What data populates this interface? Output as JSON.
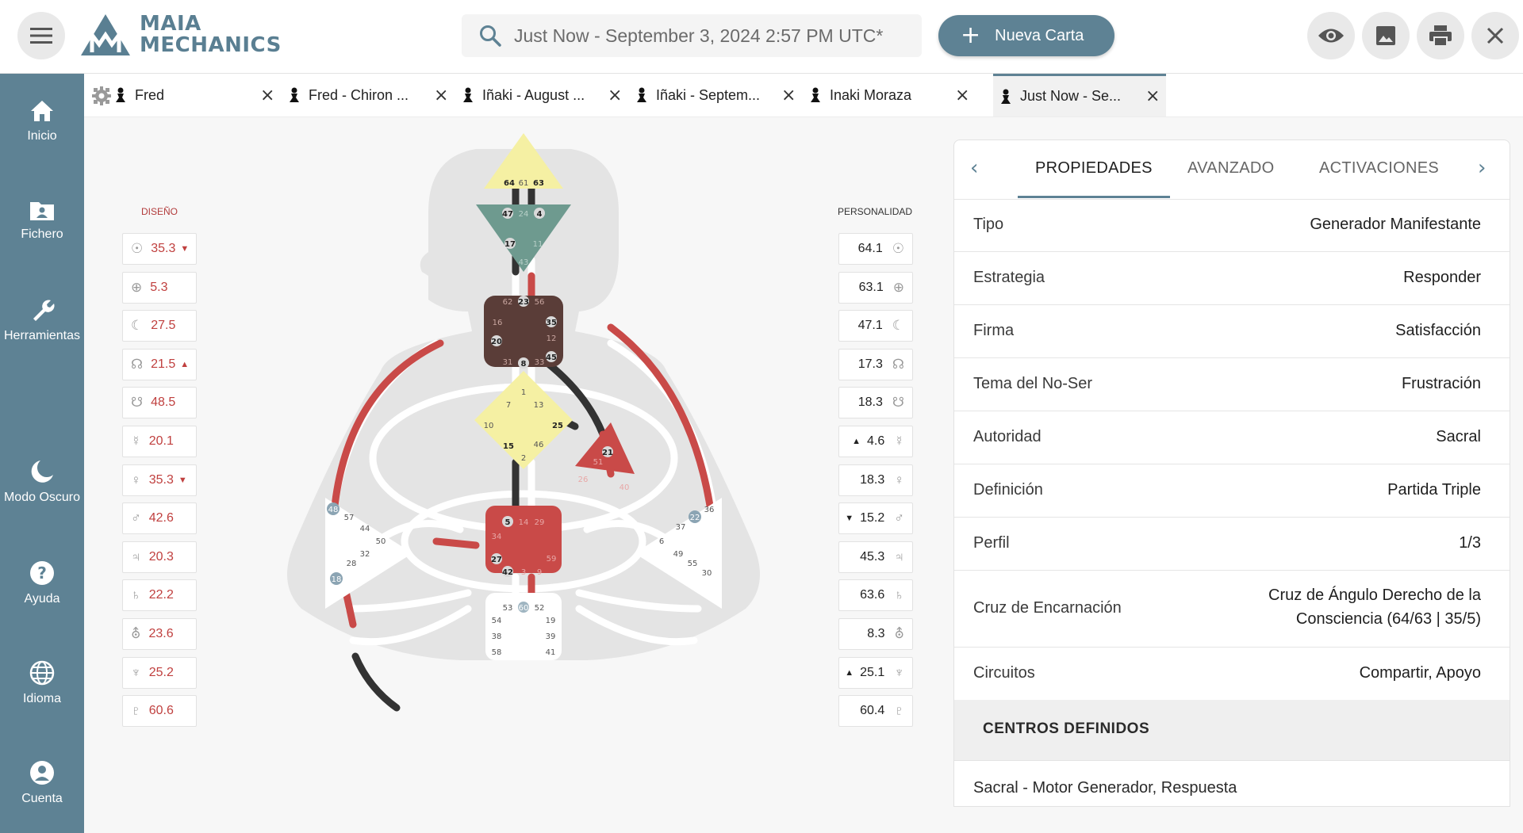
{
  "header": {
    "logo_line1": "MAIA",
    "logo_line2": "MECHANICS",
    "search_text": "Just Now - September 3, 2024 2:57 PM UTC*",
    "new_chart_label": "Nueva Carta",
    "accent_color": "#5e8294"
  },
  "sidebar": {
    "items": [
      {
        "label": "Inicio",
        "icon": "home-icon"
      },
      {
        "label": "Fichero",
        "icon": "folder-user-icon"
      },
      {
        "label": "Herramientas",
        "icon": "wrench-icon"
      },
      {
        "label": "Modo Oscuro",
        "icon": "moon-icon"
      },
      {
        "label": "Ayuda",
        "icon": "help-icon"
      },
      {
        "label": "Idioma",
        "icon": "globe-icon"
      },
      {
        "label": "Cuenta",
        "icon": "account-icon"
      }
    ]
  },
  "tabs": [
    {
      "label": "Fred"
    },
    {
      "label": "Fred - Chiron ..."
    },
    {
      "label": "Iñaki - August ..."
    },
    {
      "label": "Iñaki - Septem..."
    },
    {
      "label": "Inaki Moraza"
    },
    {
      "label": "Just Now - Se..."
    }
  ],
  "chart": {
    "design_header": "DISEÑO",
    "personality_header": "PERSONALIDAD",
    "design": [
      {
        "value": "35.3",
        "symbol": "☉",
        "mark": "▼"
      },
      {
        "value": "5.3",
        "symbol": "⊕",
        "mark": ""
      },
      {
        "value": "27.5",
        "symbol": "☾",
        "mark": ""
      },
      {
        "value": "21.5",
        "symbol": "☊",
        "mark": "▲"
      },
      {
        "value": "48.5",
        "symbol": "☋",
        "mark": ""
      },
      {
        "value": "20.1",
        "symbol": "☿",
        "mark": ""
      },
      {
        "value": "35.3",
        "symbol": "♀",
        "mark": "▼"
      },
      {
        "value": "42.6",
        "symbol": "♂",
        "mark": ""
      },
      {
        "value": "20.3",
        "symbol": "♃",
        "mark": ""
      },
      {
        "value": "22.2",
        "symbol": "♄",
        "mark": ""
      },
      {
        "value": "23.6",
        "symbol": "⛢",
        "mark": ""
      },
      {
        "value": "25.2",
        "symbol": "♆",
        "mark": ""
      },
      {
        "value": "60.6",
        "symbol": "♇",
        "mark": ""
      }
    ],
    "personality": [
      {
        "value": "64.1",
        "symbol": "☉",
        "mark": ""
      },
      {
        "value": "63.1",
        "symbol": "⊕",
        "mark": ""
      },
      {
        "value": "47.1",
        "symbol": "☾",
        "mark": ""
      },
      {
        "value": "17.3",
        "symbol": "☊",
        "mark": ""
      },
      {
        "value": "18.3",
        "symbol": "☋",
        "mark": ""
      },
      {
        "value": "4.6",
        "symbol": "☿",
        "mark": "▲"
      },
      {
        "value": "18.3",
        "symbol": "♀",
        "mark": ""
      },
      {
        "value": "15.2",
        "symbol": "♂",
        "mark": "▼"
      },
      {
        "value": "45.3",
        "symbol": "♃",
        "mark": ""
      },
      {
        "value": "63.6",
        "symbol": "♄",
        "mark": ""
      },
      {
        "value": "8.3",
        "symbol": "⛢",
        "mark": ""
      },
      {
        "value": "25.1",
        "symbol": "♆",
        "mark": "▲"
      },
      {
        "value": "60.4",
        "symbol": "♇",
        "mark": ""
      }
    ],
    "centers": {
      "head": {
        "gates": [
          "64",
          "61",
          "63"
        ],
        "color": "#f5f0a3"
      },
      "ajna": {
        "gates": [
          "47",
          "24",
          "4",
          "17",
          "11",
          "43"
        ],
        "color": "#6e9a8f"
      },
      "throat": {
        "gates": [
          "62",
          "23",
          "56",
          "16",
          "35",
          "12",
          "20",
          "45",
          "31",
          "8",
          "33"
        ],
        "color": "#5a3d38"
      },
      "g": {
        "gates": [
          "1",
          "7",
          "13",
          "10",
          "25",
          "15",
          "46",
          "2"
        ],
        "color": "#f5f0a3"
      },
      "heart": {
        "gates": [
          "21",
          "51",
          "26",
          "40"
        ],
        "color": "#c94a48"
      },
      "sacral": {
        "gates": [
          "5",
          "14",
          "29",
          "34",
          "59",
          "27",
          "42",
          "3",
          "9"
        ],
        "color": "#c94a48"
      },
      "root": {
        "gates": [
          "53",
          "60",
          "52",
          "54",
          "19",
          "38",
          "39",
          "58",
          "41"
        ],
        "color": "#ffffff"
      },
      "spleen": {
        "gates": [
          "48",
          "57",
          "44",
          "50",
          "32",
          "28",
          "18"
        ],
        "color": "#ffffff"
      },
      "solar": {
        "gates": [
          "36",
          "22",
          "37",
          "6",
          "49",
          "55",
          "30"
        ],
        "color": "#ffffff"
      }
    }
  },
  "panel": {
    "tabs": [
      "PROPIEDADES",
      "AVANZADO",
      "ACTIVACIONES"
    ],
    "rows": [
      {
        "key": "Tipo",
        "value": "Generador Manifestante"
      },
      {
        "key": "Estrategia",
        "value": "Responder"
      },
      {
        "key": "Firma",
        "value": "Satisfacción"
      },
      {
        "key": "Tema del No-Ser",
        "value": "Frustración"
      },
      {
        "key": "Autoridad",
        "value": "Sacral"
      },
      {
        "key": "Definición",
        "value": "Partida Triple"
      },
      {
        "key": "Perfil",
        "value": "1/3"
      },
      {
        "key": "Cruz de Encarnación",
        "value": "Cruz de Ángulo Derecho de la",
        "value2": "Consciencia (64/63 | 35/5)"
      },
      {
        "key": "Circuitos",
        "value": "Compartir, Apoyo"
      }
    ],
    "section_title": "CENTROS DEFINIDOS",
    "section_item": "Sacral - Motor Generador, Respuesta"
  }
}
